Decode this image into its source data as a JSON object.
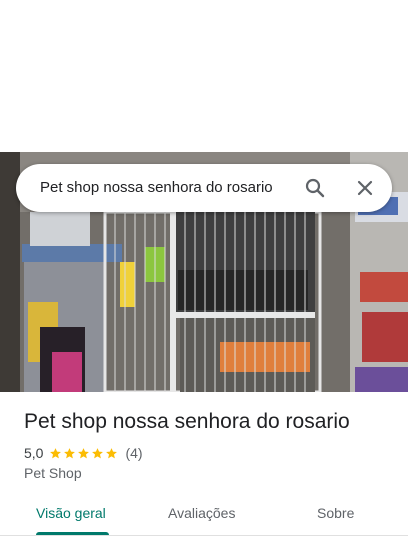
{
  "search": {
    "query": "Pet shop nossa senhora do rosario",
    "search_icon": "search-icon",
    "clear_icon": "close-icon"
  },
  "place": {
    "title": "Pet shop nossa senhora do rosario",
    "rating": "5,0",
    "rating_stars": 5,
    "review_count": "(4)",
    "category": "Pet Shop"
  },
  "tabs": [
    {
      "label": "Visão geral",
      "active": true
    },
    {
      "label": "Avaliações",
      "active": false
    },
    {
      "label": "Sobre",
      "active": false
    }
  ],
  "colors": {
    "accent": "#00796b",
    "star": "#fbbc04",
    "secondary_text": "#5f6368"
  }
}
